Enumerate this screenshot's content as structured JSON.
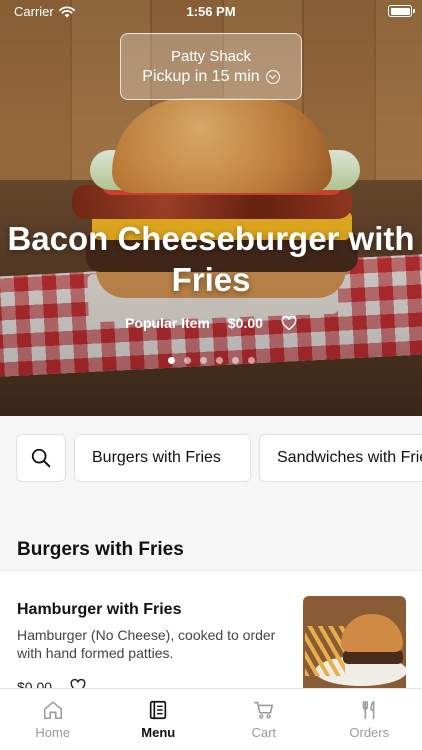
{
  "status_bar": {
    "carrier": "Carrier",
    "time": "1:56 PM"
  },
  "store": {
    "name": "Patty Shack",
    "pickup": "Pickup in 15 min"
  },
  "featured": {
    "title": "Bacon Cheeseburger with Fries",
    "tag": "Popular Item",
    "price": "$0.00",
    "carousel_count": 6,
    "carousel_active_index": 0
  },
  "categories": [
    "Burgers with Fries",
    "Sandwiches with Fries"
  ],
  "section": {
    "title": "Burgers with Fries"
  },
  "items": [
    {
      "name": "Hamburger with Fries",
      "description": "Hamburger (No Cheese), cooked to order with hand formed patties.",
      "price": "$0.00"
    }
  ],
  "tabs": [
    {
      "label": "Home",
      "icon": "home-icon",
      "active": false
    },
    {
      "label": "Menu",
      "icon": "menu-book-icon",
      "active": true
    },
    {
      "label": "Cart",
      "icon": "cart-icon",
      "active": false
    },
    {
      "label": "Orders",
      "icon": "utensils-icon",
      "active": false
    }
  ]
}
